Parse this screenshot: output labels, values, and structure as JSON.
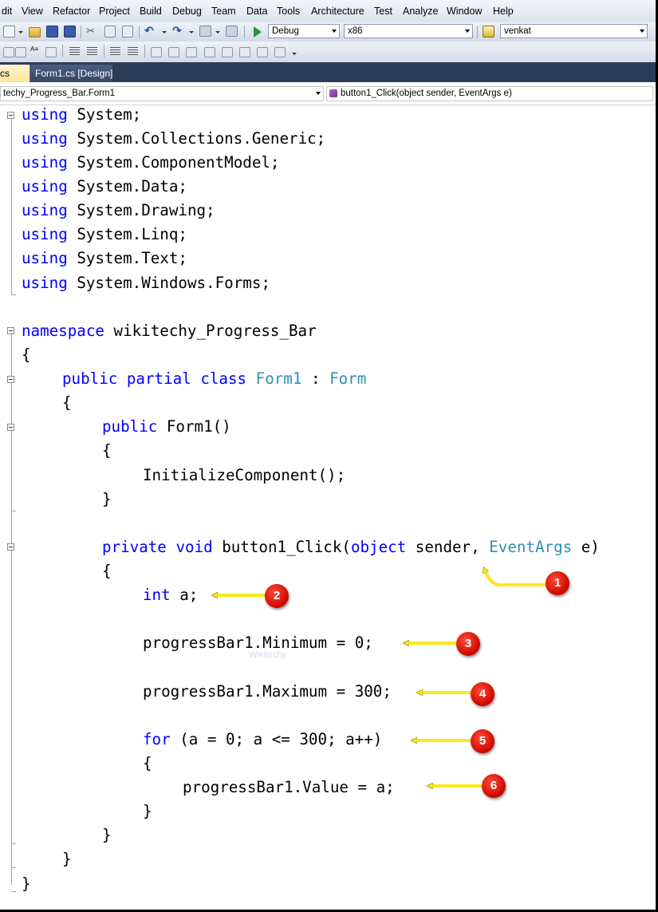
{
  "menu": [
    "dit",
    "View",
    "Refactor",
    "Project",
    "Build",
    "Debug",
    "Team",
    "Data",
    "Tools",
    "Architecture",
    "Test",
    "Analyze",
    "Window",
    "Help"
  ],
  "toolbar": {
    "config": "Debug",
    "platform": "x86",
    "find": "venkat"
  },
  "tabs": {
    "active": "cs",
    "design": "Form1.cs [Design]"
  },
  "nav": {
    "type": "techy_Progress_Bar.Form1",
    "member": "button1_Click(object sender, EventArgs e)"
  },
  "code": {
    "u1": "System;",
    "u2": "System.Collections.Generic;",
    "u3": "System.ComponentModel;",
    "u4": "System.Data;",
    "u5": "System.Drawing;",
    "u6": "System.Linq;",
    "u7": "System.Text;",
    "u8": "System.Windows.Forms;",
    "kw_using": "using",
    "kw_namespace": "namespace",
    "ns_name": " wikitechy_Progress_Bar",
    "brace_open": "{",
    "brace_close": "}",
    "kw_public": "public",
    "kw_partial": "partial",
    "kw_class": "class",
    "class_name": "Form1",
    "colon": " : ",
    "base_class": "Form",
    "ctor": " Form1()",
    "init": "InitializeComponent();",
    "kw_private": "private",
    "kw_void": "void",
    "method_name": " button1_Click(",
    "kw_object": "object",
    "param_sender": " sender, ",
    "type_eventargs": "EventArgs",
    "param_e": " e)",
    "kw_int": "int",
    "decl_a": " a;",
    "set_min": "progressBar1.Minimum = 0;",
    "set_max": "progressBar1.Maximum = 300;",
    "kw_for": "for",
    "for_rest": " (a = 0; a <= 300; a++)",
    "set_value": "progressBar1.Value = a;"
  },
  "watermark": "Wikitechy",
  "callouts": [
    "1",
    "2",
    "3",
    "4",
    "5",
    "6"
  ],
  "colors": {
    "keyword": "#0000ff",
    "type": "#2b91af",
    "arrow": "#ffe71a",
    "badge": "#d10a00"
  }
}
